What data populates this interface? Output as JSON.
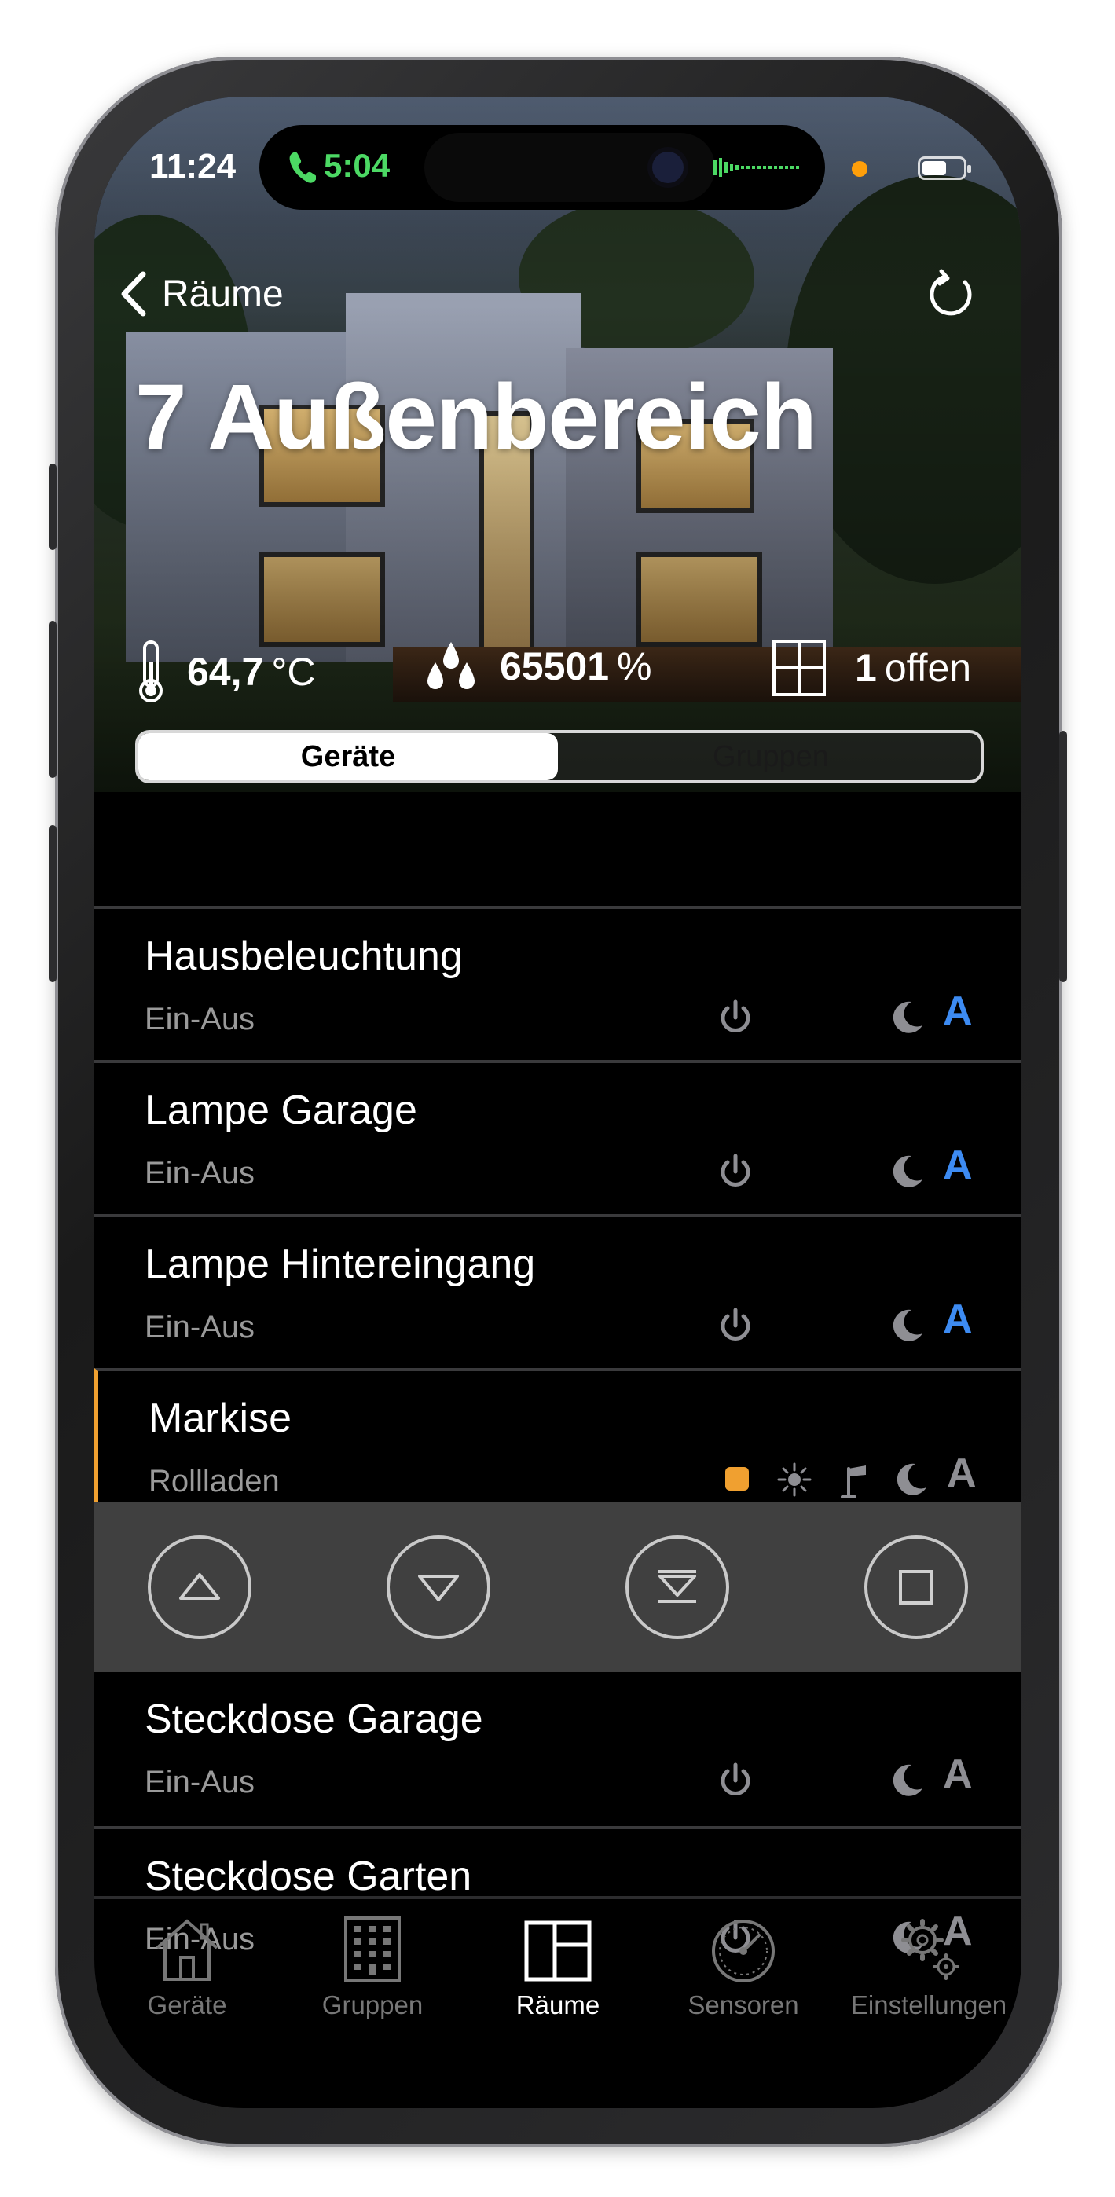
{
  "status": {
    "time": "11:24",
    "call_time": "5:04"
  },
  "nav": {
    "back_label": "Räume"
  },
  "room": {
    "title": "7 Außenbereich"
  },
  "stats": {
    "temperature_value": "64,7",
    "temperature_unit": "°C",
    "humidity_value": "65501",
    "humidity_unit": "%",
    "window_value": "1",
    "window_label": "offen"
  },
  "segment": {
    "devices": "Geräte",
    "groups": "Gruppen"
  },
  "devices": [
    {
      "name": "Hausbeleuchtung",
      "type": "Ein-Aus",
      "auto_active": true
    },
    {
      "name": "Lampe Garage",
      "type": "Ein-Aus",
      "auto_active": true
    },
    {
      "name": "Lampe Hintereingang",
      "type": "Ein-Aus",
      "auto_active": true
    },
    {
      "name": "Markise",
      "type": "Rollladen",
      "auto_active": false
    },
    {
      "name": "Steckdose Garage",
      "type": "Ein-Aus",
      "auto_active": false
    },
    {
      "name": "Steckdose Garten",
      "type": "Ein-Aus",
      "auto_active": false
    }
  ],
  "auto_letter": "A",
  "colors": {
    "accent_blue": "#3d8bf2",
    "selected_orange": "#f0a030",
    "icon_gray": "#8e8e93"
  },
  "tabs": [
    {
      "label": "Geräte",
      "icon": "house-icon"
    },
    {
      "label": "Gruppen",
      "icon": "building-icon"
    },
    {
      "label": "Räume",
      "icon": "rooms-icon",
      "active": true
    },
    {
      "label": "Sensoren",
      "icon": "gauge-icon"
    },
    {
      "label": "Einstellungen",
      "icon": "gears-icon"
    }
  ]
}
